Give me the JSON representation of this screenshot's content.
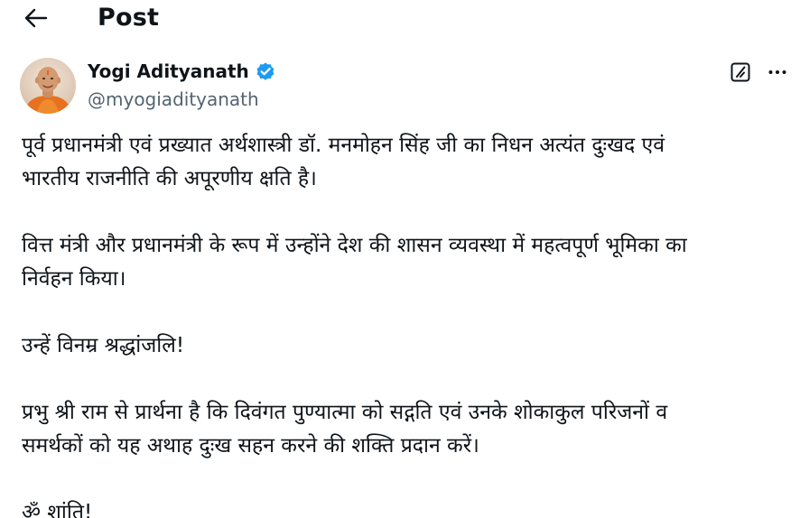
{
  "header": {
    "back_icon": "arrow-left-icon",
    "title": "Post"
  },
  "author": {
    "name": "Yogi Adityanath",
    "handle": "@myogiadityanath",
    "verified": true,
    "verified_color": "#1d9bf0",
    "avatar_icon": "avatar-photo"
  },
  "actions": {
    "grok_icon": "grok-icon",
    "more_icon": "more-icon"
  },
  "tweet": {
    "paragraphs": [
      {
        "lines": [
          "पूर्व प्रधानमंत्री एवं प्रख्यात अर्थशास्त्री डॉ. मनमोहन सिंह जी का निधन अत्यंत दुःखद एवं",
          "भारतीय राजनीति की अपूरणीय क्षति है।"
        ]
      },
      {
        "lines": [
          "वित्त मंत्री और प्रधानमंत्री के रूप में उन्होंने देश की शासन व्यवस्था में महत्वपूर्ण भूमिका का",
          "निर्वहन किया।"
        ]
      },
      {
        "lines": [
          "उन्हें विनम्र श्रद्धांजलि!"
        ]
      },
      {
        "lines": [
          "प्रभु श्री राम से प्रार्थना है कि दिवंगत पुण्यात्मा को सद्गति एवं उनके शोकाकुल परिजनों व",
          "समर्थकों को यह अथाह दुःख सहन करने की शक्ति प्रदान करें।"
        ]
      },
      {
        "lines": [
          "ॐ शांति!"
        ]
      }
    ]
  }
}
